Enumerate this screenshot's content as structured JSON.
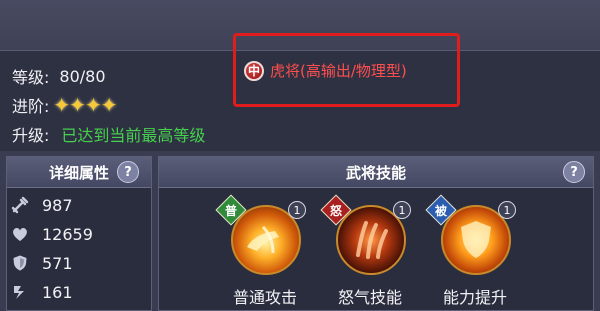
{
  "info": {
    "level_label": "等级:",
    "level_value": "80/80",
    "advance_label": "进阶:",
    "advance_stars": 4,
    "upgrade_label": "升级:",
    "upgrade_value": "已达到当前最高等级",
    "type_icon_text": "中",
    "type_text": "虎将(高输出/物理型)"
  },
  "attributes_panel": {
    "title": "详细属性",
    "help": "?",
    "items": [
      {
        "icon": "sword-icon",
        "value": "987"
      },
      {
        "icon": "heart-icon",
        "value": "12659"
      },
      {
        "icon": "shield-icon",
        "value": "571"
      },
      {
        "icon": "speed-icon",
        "value": "161"
      }
    ]
  },
  "skills_panel": {
    "title": "武将技能",
    "help": "?",
    "skills": [
      {
        "badge": "普",
        "badge_color": "#2f8a3a",
        "level": "1",
        "name": "普通攻击"
      },
      {
        "badge": "怒",
        "badge_color": "#a82020",
        "level": "1",
        "name": "怒气技能"
      },
      {
        "badge": "被",
        "badge_color": "#2a5db0",
        "level": "1",
        "name": "能力提升"
      }
    ]
  },
  "colors": {
    "max_level_text": "#46d04e",
    "type_text": "#ff4e4e",
    "highlight_box": "#e01c1c",
    "star": "#f5c93a"
  }
}
